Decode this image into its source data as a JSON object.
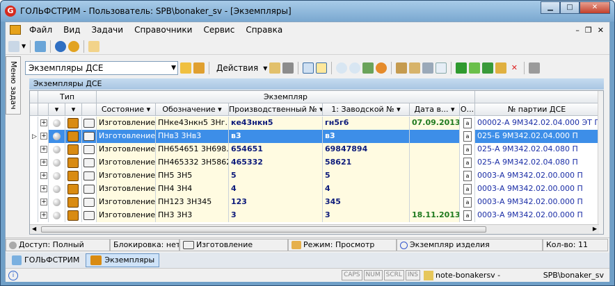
{
  "window": {
    "title": "ГОЛЬФСТРИМ - Пользователь: SPB\\bonaker_sv - [Экземпляры]",
    "app_letter": "G"
  },
  "menu": [
    {
      "label": "Файл",
      "key": "Ф"
    },
    {
      "label": "Вид",
      "key": "В"
    },
    {
      "label": "Задачи",
      "key": "З"
    },
    {
      "label": "Справочники",
      "key": ""
    },
    {
      "label": "Сервис",
      "key": "С"
    },
    {
      "label": "Справка",
      "key": "С"
    }
  ],
  "side_tab": "Меню задач",
  "toolbar2": {
    "combo_value": "Экземпляры ДСЕ",
    "actions_label": "Действия"
  },
  "caption": "Экземпляры ДСЕ",
  "grid": {
    "group_headers": {
      "type": "Тип",
      "instance": "Экземпляр"
    },
    "columns": [
      "Состояние",
      "Обозначение",
      "Производственный №",
      "1: Заводской №",
      "Дата в...",
      "О...",
      "№ партии ДСЕ"
    ],
    "rows": [
      {
        "state": "Изготовление",
        "designation": "ПНке43нкн5 3Нг...",
        "prod_no": "ке43нкн5",
        "factory_no": "гн5г6",
        "date": "07.09.2013",
        "batch": "00002-А 9М342.02.04.000 ЭТ П",
        "selected": false
      },
      {
        "state": "Изготовление",
        "designation": "ПНв3 3Нв3",
        "prod_no": "в3",
        "factory_no": "в3",
        "date": "",
        "batch": "025-Б 9М342.02.04.000 П",
        "selected": true
      },
      {
        "state": "Изготовление",
        "designation": "ПН654651 3Н698...",
        "prod_no": "654651",
        "factory_no": "69847894",
        "date": "",
        "batch": "025-А 9М342.02.04.080 П",
        "selected": false
      },
      {
        "state": "Изготовление",
        "designation": "ПН465332 3Н58621",
        "prod_no": "465332",
        "factory_no": "58621",
        "date": "",
        "batch": "025-А 9М342.02.04.080 П",
        "selected": false
      },
      {
        "state": "Изготовление",
        "designation": "ПН5 3Н5",
        "prod_no": "5",
        "factory_no": "5",
        "date": "",
        "batch": "0003-А 9М342.02.00.000 П",
        "selected": false
      },
      {
        "state": "Изготовление",
        "designation": "ПН4 3Н4",
        "prod_no": "4",
        "factory_no": "4",
        "date": "",
        "batch": "0003-А 9М342.02.00.000 П",
        "selected": false
      },
      {
        "state": "Изготовление",
        "designation": "ПН123 3Н345",
        "prod_no": "123",
        "factory_no": "345",
        "date": "",
        "batch": "0003-А 9М342.02.00.000 П",
        "selected": false
      },
      {
        "state": "Изготовление",
        "designation": "ПН3 3Н3",
        "prod_no": "3",
        "factory_no": "3",
        "date": "18.11.2013",
        "batch": "0003-А 9М342.02.00.000 П",
        "selected": false
      }
    ]
  },
  "status": {
    "access": "Доступ: Полный",
    "lock": "Блокировка: нет",
    "state": "Изготовление",
    "mode": "Режим: Просмотр",
    "instance": "Экземпляр изделия",
    "count": "Кол-во: 11"
  },
  "tasks": [
    "ГОЛЬФСТРИМ",
    "Экземпляры"
  ],
  "bottom": {
    "caps": "CAPS",
    "num": "NUM",
    "scrl": "SCRL",
    "ins": "INS",
    "host": "note-bonakersv -",
    "user": "SPB\\bonaker_sv"
  }
}
